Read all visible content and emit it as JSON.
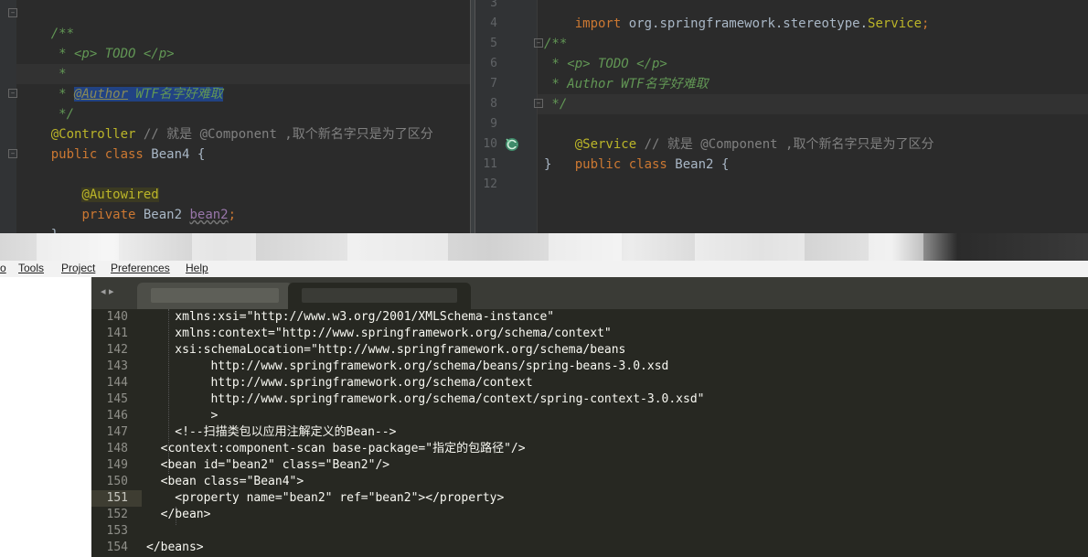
{
  "left_editor": {
    "lines": [
      {
        "text": "/**",
        "kind": "comment"
      },
      {
        "text": " * <p> TODO </p>",
        "kind": "comment"
      },
      {
        "text": " *",
        "kind": "comment"
      },
      {
        "prefix": " * ",
        "annotation": "@Author",
        "rest": " WTF名字好难取",
        "kind": "comment-author"
      },
      {
        "text": " */",
        "kind": "comment"
      },
      {
        "annotation": "@Controller",
        "rest": " // 就是 @Component ,取个新名字只是为了区分"
      },
      {
        "kw": "public class",
        "rest": " Bean4 {"
      },
      {
        "text": ""
      },
      {
        "indent": "    ",
        "annotation": "@Autowired"
      },
      {
        "indent": "    ",
        "kw": "private",
        "type": " Bean2 ",
        "field": "bean2",
        "end": ";"
      },
      {
        "text": "}"
      }
    ]
  },
  "right_editor": {
    "line_numbers": [
      "3",
      "4",
      "5",
      "6",
      "7",
      "8",
      "9",
      "10",
      "11",
      "12"
    ],
    "lines": [
      {
        "kw": "import",
        "rest": " org.springframework.stereotype.",
        "cls": "Service",
        "end": ";"
      },
      {
        "text": ""
      },
      {
        "text": "/**",
        "kind": "comment"
      },
      {
        "text": " * <p> TODO </p>",
        "kind": "comment"
      },
      {
        "text": " * Author WTF名字好难取",
        "kind": "comment"
      },
      {
        "text": " */",
        "kind": "comment"
      },
      {
        "annotation": "@Service",
        "rest": " // 就是 @Component ,取个新名字只是为了区分"
      },
      {
        "kw": "public class",
        "rest": " Bean2 {"
      },
      {
        "text": "}"
      },
      {
        "text": ""
      }
    ],
    "gutter_icon": "spring-bean-icon"
  },
  "menu_bar": {
    "items": [
      "o",
      "Tools",
      "Project",
      "Preferences",
      "Help"
    ]
  },
  "bottom_editor": {
    "nav_arrows": "◂ ▸",
    "active_line": "151",
    "lines": [
      {
        "n": "140",
        "text": "    xmlns:xsi=\"http://www.w3.org/2001/XMLSchema-instance\""
      },
      {
        "n": "141",
        "text": "    xmlns:context=\"http://www.springframework.org/schema/context\""
      },
      {
        "n": "142",
        "text": "    xsi:schemaLocation=\"http://www.springframework.org/schema/beans"
      },
      {
        "n": "143",
        "text": "         http://www.springframework.org/schema/beans/spring-beans-3.0.xsd"
      },
      {
        "n": "144",
        "text": "         http://www.springframework.org/schema/context"
      },
      {
        "n": "145",
        "text": "         http://www.springframework.org/schema/context/spring-context-3.0.xsd\""
      },
      {
        "n": "146",
        "text": "         >"
      },
      {
        "n": "147",
        "text": "    <!--扫描类包以应用注解定义的Bean-->"
      },
      {
        "n": "148",
        "text": "  <context:component-scan base-package=\"指定的包路径\"/>"
      },
      {
        "n": "149",
        "text": "  <bean id=\"bean2\" class=\"Bean2\"/>"
      },
      {
        "n": "150",
        "text": "  <bean class=\"Bean4\">"
      },
      {
        "n": "151",
        "text": "    <property name=\"bean2\" ref=\"bean2\"></property>"
      },
      {
        "n": "152",
        "text": "  </bean>"
      },
      {
        "n": "153",
        "text": ""
      },
      {
        "n": "154",
        "text": "</beans>"
      }
    ]
  }
}
